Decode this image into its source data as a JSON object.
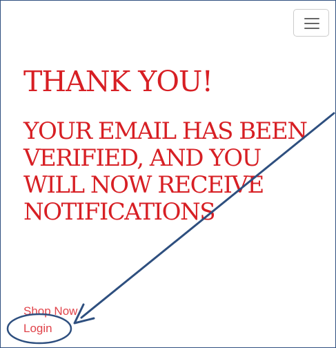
{
  "header": {
    "menu_icon": "hamburger-menu-icon"
  },
  "main": {
    "title": "THANK YOU!",
    "message": "YOUR EMAIL HAS BEEN VERIFIED, AND YOU WILL NOW RECEIVE NOTIFICATIONS"
  },
  "links": {
    "shop_now": "Shop Now",
    "login": "Login"
  },
  "colors": {
    "heading": "#d71f24",
    "link": "#e0434a",
    "annotation": "#2e4f7f",
    "frame_border": "#2e4f7f"
  }
}
